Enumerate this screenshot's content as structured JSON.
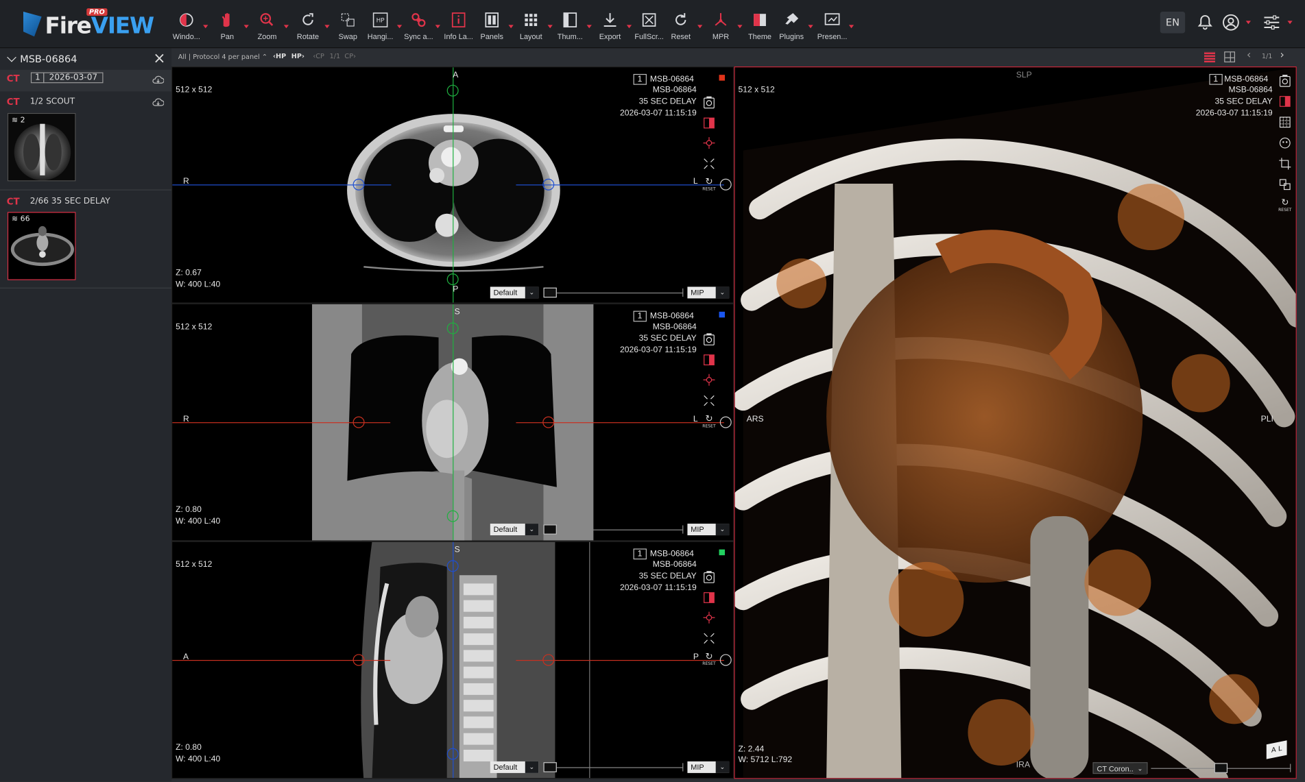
{
  "app": {
    "logo_text_fire": "Fire",
    "logo_text_view": "VIEW",
    "logo_badge": "PRO"
  },
  "toolbar": [
    {
      "label": "Windo...",
      "icon": "window-level-icon",
      "dropdown": true
    },
    {
      "label": "Pan",
      "icon": "pan-hand-icon",
      "dropdown": true
    },
    {
      "label": "Zoom",
      "icon": "zoom-icon",
      "dropdown": true
    },
    {
      "label": "Rotate",
      "icon": "rotate-icon",
      "dropdown": true
    },
    {
      "label": "Swap",
      "icon": "swap-icon",
      "dropdown": false
    },
    {
      "label": "Hangi...",
      "icon": "hanging-protocol-icon",
      "dropdown": true
    },
    {
      "label": "Sync a...",
      "icon": "sync-icon",
      "dropdown": true
    },
    {
      "label": "Info La...",
      "icon": "info-layer-icon",
      "dropdown": false
    },
    {
      "label": "Panels",
      "icon": "panels-icon",
      "dropdown": true
    },
    {
      "label": "Layout",
      "icon": "layout-grid-icon",
      "dropdown": true
    },
    {
      "label": "Thum...",
      "icon": "thumbnail-icon",
      "dropdown": true
    },
    {
      "label": "Export",
      "icon": "export-icon",
      "dropdown": true
    },
    {
      "label": "FullScr...",
      "icon": "fullscreen-icon",
      "dropdown": false
    },
    {
      "label": "Reset",
      "icon": "reset-icon",
      "dropdown": true
    },
    {
      "label": "MPR",
      "icon": "mpr-icon",
      "dropdown": true
    },
    {
      "label": "Theme",
      "icon": "theme-icon",
      "dropdown": false
    },
    {
      "label": "Plugins",
      "icon": "plugins-icon",
      "dropdown": true
    },
    {
      "label": "Presen...",
      "icon": "presentation-icon",
      "dropdown": true
    }
  ],
  "header_right": {
    "language": "EN"
  },
  "sidebar": {
    "patient_id": "MSB-06864",
    "study": {
      "modality": "CT",
      "number": "1",
      "date": "2026-03-07"
    },
    "series": [
      {
        "modality": "CT",
        "label": "1/2 SCOUT",
        "count": "2"
      },
      {
        "modality": "CT",
        "label": "2/66 35 SEC DELAY",
        "count": "66"
      }
    ]
  },
  "viewbar": {
    "protocol": "All | Protocol 4 per panel",
    "hp_prev": "HP",
    "hp_next": "HP",
    "cp_prev": "CP",
    "cp_page": "1/1",
    "cp_next": "CP",
    "page": "1/1"
  },
  "viewports": [
    {
      "id": "axial",
      "matrix": "512 x 512",
      "num": "1",
      "patient": "MSB-06864",
      "series": "35 SEC DELAY",
      "datetime": "2026-03-07 11:15:19",
      "zoom": "Z: 0.67",
      "wl": "W: 400 L:40",
      "top": "A",
      "bottom": "P",
      "left": "R",
      "right": "L",
      "preset": "Default",
      "render": "MIP",
      "color": "#e0341a",
      "reset": "RESET"
    },
    {
      "id": "coronal",
      "matrix": "512 x 512",
      "num": "1",
      "patient": "MSB-06864",
      "series": "35 SEC DELAY",
      "datetime": "2026-03-07 11:15:19",
      "zoom": "Z: 0.80",
      "wl": "W: 400 L:40",
      "top": "S",
      "bottom": "",
      "left": "R",
      "right": "L",
      "preset": "Default",
      "render": "MIP",
      "color": "#1a56f0",
      "reset": "RESET"
    },
    {
      "id": "sagittal",
      "matrix": "512 x 512",
      "num": "1",
      "patient": "MSB-06864",
      "series": "35 SEC DELAY",
      "datetime": "2026-03-07 11:15:19",
      "zoom": "Z: 0.80",
      "wl": "W: 400 L:40",
      "top": "S",
      "bottom": "",
      "left": "A",
      "right": "P",
      "preset": "Default",
      "render": "MIP",
      "color": "#22d060",
      "reset": "RESET"
    },
    {
      "id": "volume",
      "matrix": "512 x 512",
      "num": "1",
      "patient": "MSB-06864",
      "series": "35 SEC DELAY",
      "datetime": "2026-03-07 11:15:19",
      "zoom": "Z: 2.44",
      "wl": "W: 5712 L:792",
      "top": "SLP",
      "bottom": "IRA",
      "left": "ARS",
      "right": "PLI",
      "preset": "CT Coron...",
      "reset": "RESET",
      "cube": "A L"
    }
  ]
}
